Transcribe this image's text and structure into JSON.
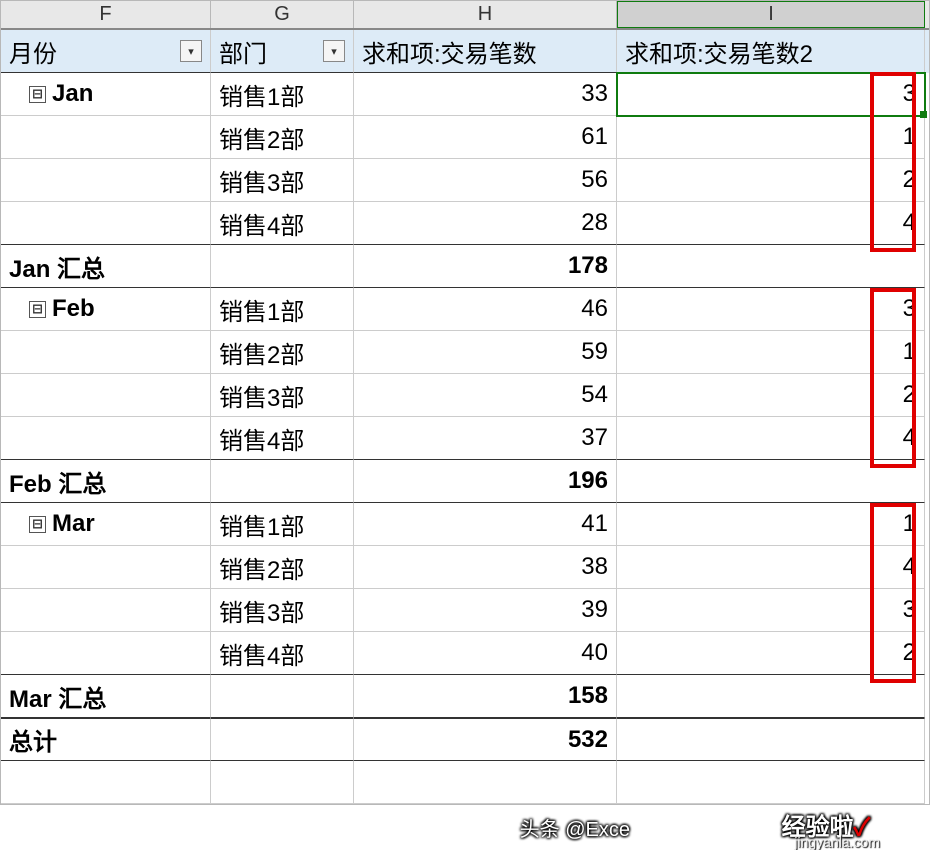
{
  "columns": {
    "f": "F",
    "g": "G",
    "h": "H",
    "i": "I"
  },
  "headers": {
    "month": "月份",
    "dept": "部门",
    "sum1": "求和项:交易笔数",
    "sum2": "求和项:交易笔数2"
  },
  "dropdown_glyph": "▾",
  "collapse_glyph": "⊟",
  "groups": [
    {
      "name": "Jan",
      "rows": [
        {
          "dept": "销售1部",
          "v1": "33",
          "v2": "3",
          "selected": true
        },
        {
          "dept": "销售2部",
          "v1": "61",
          "v2": "1"
        },
        {
          "dept": "销售3部",
          "v1": "56",
          "v2": "2"
        },
        {
          "dept": "销售4部",
          "v1": "28",
          "v2": "4"
        }
      ],
      "subtotal_label": "Jan 汇总",
      "subtotal_v1": "178"
    },
    {
      "name": "Feb",
      "rows": [
        {
          "dept": "销售1部",
          "v1": "46",
          "v2": "3"
        },
        {
          "dept": "销售2部",
          "v1": "59",
          "v2": "1"
        },
        {
          "dept": "销售3部",
          "v1": "54",
          "v2": "2"
        },
        {
          "dept": "销售4部",
          "v1": "37",
          "v2": "4"
        }
      ],
      "subtotal_label": "Feb 汇总",
      "subtotal_v1": "196"
    },
    {
      "name": "Mar",
      "rows": [
        {
          "dept": "销售1部",
          "v1": "41",
          "v2": "1"
        },
        {
          "dept": "销售2部",
          "v1": "38",
          "v2": "4"
        },
        {
          "dept": "销售3部",
          "v1": "39",
          "v2": "3"
        },
        {
          "dept": "销售4部",
          "v1": "40",
          "v2": "2"
        }
      ],
      "subtotal_label": "Mar 汇总",
      "subtotal_v1": "158"
    }
  ],
  "grand": {
    "label": "总计",
    "v1": "532"
  },
  "watermark": {
    "w1": "头条 @Exce",
    "w2_a": "经验啦",
    "w2_check": "✓",
    "w3": "jingyanla.com"
  }
}
